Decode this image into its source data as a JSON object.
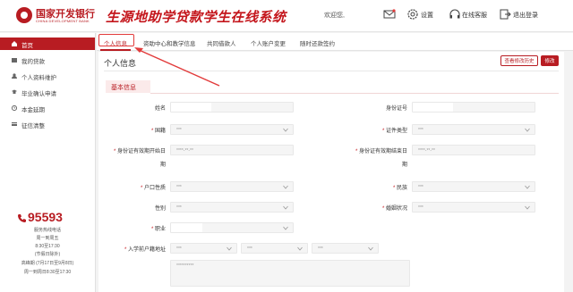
{
  "header": {
    "bank_name_cn": "国家开发银行",
    "bank_name_en": "CHINA DEVELOPMENT BANK",
    "system_title": "生源地助学贷款学生在线系统",
    "welcome": "欢迎您,",
    "settings": "设置",
    "online_service": "在线客服",
    "logout": "退出登录"
  },
  "sidebar": {
    "items": [
      {
        "label": "首页"
      },
      {
        "label": "我的贷款"
      },
      {
        "label": "个人资料维护"
      },
      {
        "label": "毕业确认申请"
      },
      {
        "label": "本金延期"
      },
      {
        "label": "征信清整"
      }
    ],
    "hotline": "95593",
    "support_lines": [
      "服务热线电话",
      "周一到周五",
      "8:30至17:30",
      "(节假日除外)",
      "高峰期 (7月17日至9月8日)",
      "周一到周日8:30至17:30"
    ]
  },
  "tabs": [
    "个人信息",
    "资助中心和教学信息",
    "共同借款人",
    "个人账户变更",
    "随时还款签约"
  ],
  "main": {
    "page_title": "个人信息",
    "btn_modify_record": "查看修改历史",
    "btn_edit": "修改",
    "section_title": "基本信息",
    "fields": {
      "name": {
        "label": "姓名",
        "value": ""
      },
      "id_no": {
        "label": "身份证号",
        "value": ""
      },
      "nationality": {
        "label": "国籍",
        "value": "***"
      },
      "cert_type": {
        "label": "证件类型",
        "value": "***"
      },
      "id_start": {
        "label_1": "身份证有效期开始日",
        "label_2": "期",
        "value": "****-**-**"
      },
      "id_end": {
        "label_1": "身份证有效期结束日",
        "label_2": "期",
        "value": "****-**-**"
      },
      "hukou": {
        "label": "户口性质",
        "value": "***"
      },
      "ethnicity": {
        "label": "民族",
        "value": "***"
      },
      "gender": {
        "label": "性别",
        "value": "***"
      },
      "marital": {
        "label": "婚姻状况",
        "value": "***"
      },
      "occupation": {
        "label": "职业",
        "value": ""
      },
      "address": {
        "label": "入学前户籍地址",
        "values": [
          "***",
          "***",
          "***"
        ],
        "detail": "**********"
      }
    }
  }
}
